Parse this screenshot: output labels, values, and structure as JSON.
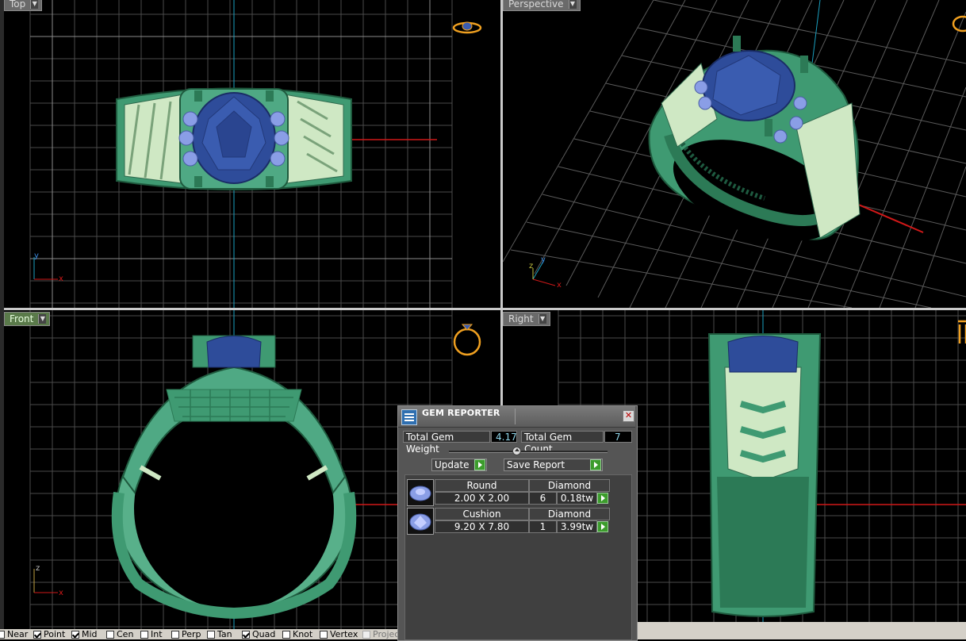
{
  "viewports": {
    "top": {
      "label": "Top"
    },
    "perspective": {
      "label": "Perspective"
    },
    "front": {
      "label": "Front"
    },
    "right": {
      "label": "Right"
    }
  },
  "axes": {
    "x": "x",
    "y": "y",
    "z": "z"
  },
  "gem_reporter": {
    "title": "GEM REPORTER",
    "total_weight_label": "Total Gem Weight",
    "total_weight_value": "4.17",
    "total_count_label": "Total Gem Count",
    "total_count_value": "7",
    "update_label": "Update",
    "save_label": "Save Report",
    "gems": [
      {
        "shape": "Round",
        "size": "2.00 X 2.00",
        "type": "Diamond",
        "count": "6",
        "weight": "0.18tw"
      },
      {
        "shape": "Cushion",
        "size": "9.20 X 7.80",
        "type": "Diamond",
        "count": "1",
        "weight": "3.99tw"
      }
    ]
  },
  "osnaps": [
    {
      "label": "Near",
      "checked": false
    },
    {
      "label": "Point",
      "checked": true
    },
    {
      "label": "Mid",
      "checked": true
    },
    {
      "label": "Cen",
      "checked": false
    },
    {
      "label": "Int",
      "checked": false
    },
    {
      "label": "Perp",
      "checked": false
    },
    {
      "label": "Tan",
      "checked": false
    },
    {
      "label": "Quad",
      "checked": true
    },
    {
      "label": "Knot",
      "checked": false
    },
    {
      "label": "Vertex",
      "checked": false
    },
    {
      "label": "Project",
      "checked": false,
      "disabled": true
    }
  ],
  "colors": {
    "metal": "#3f9a72",
    "metal_light": "#7cc29c",
    "gem": "#2e4c9a",
    "side_stone": "#8a9ee6",
    "grid": "#4a4a4a",
    "axis_x": "#d01818",
    "axis_y": "#1aa0c0"
  }
}
